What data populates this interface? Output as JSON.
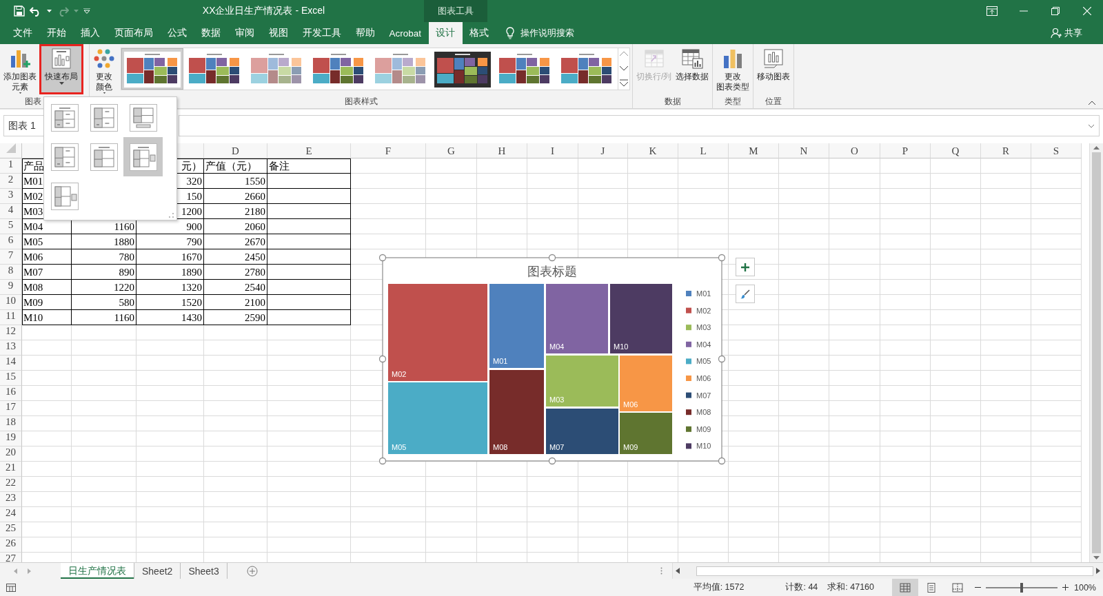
{
  "title_bar": {
    "title": "XX企业日生产情况表 - Excel",
    "context_label": "图表工具"
  },
  "ribbon_tabs": [
    {
      "label": "文件",
      "selected": false
    },
    {
      "label": "开始",
      "selected": false
    },
    {
      "label": "插入",
      "selected": false
    },
    {
      "label": "页面布局",
      "selected": false
    },
    {
      "label": "公式",
      "selected": false
    },
    {
      "label": "数据",
      "selected": false
    },
    {
      "label": "审阅",
      "selected": false
    },
    {
      "label": "视图",
      "selected": false
    },
    {
      "label": "开发工具",
      "selected": false
    },
    {
      "label": "帮助",
      "selected": false
    },
    {
      "label": "Acrobat",
      "selected": false
    },
    {
      "label": "设计",
      "selected": true
    },
    {
      "label": "格式",
      "selected": false
    }
  ],
  "tell_me": "操作说明搜索",
  "share": "共享",
  "ribbon": {
    "groups": [
      {
        "label": "图表",
        "buttons": [
          {
            "kind": "add-element",
            "lines": [
              "添加图表",
              "元素"
            ],
            "dropdown": true,
            "pressed": false,
            "highlighted": false,
            "disabled": false
          },
          {
            "kind": "quick-layout",
            "lines": [
              "快速布局"
            ],
            "dropdown": true,
            "pressed": true,
            "highlighted": true,
            "disabled": false
          }
        ]
      },
      {
        "label": "图表样式",
        "buttons": [
          {
            "kind": "colors",
            "lines": [
              "更改",
              "颜色"
            ],
            "dropdown": true,
            "pressed": false,
            "highlighted": false,
            "disabled": false
          }
        ],
        "gallery": [
          {
            "kind": "light",
            "selected": true
          },
          {
            "kind": "light",
            "selected": false
          },
          {
            "kind": "pale",
            "selected": false
          },
          {
            "kind": "light",
            "selected": false
          },
          {
            "kind": "pale",
            "selected": false
          },
          {
            "kind": "dark",
            "selected": false
          },
          {
            "kind": "light",
            "selected": false
          },
          {
            "kind": "light",
            "selected": false
          }
        ]
      },
      {
        "label": "数据",
        "buttons": [
          {
            "kind": "switch",
            "lines": [
              "切换行/列"
            ],
            "dropdown": false,
            "pressed": false,
            "highlighted": false,
            "disabled": true
          },
          {
            "kind": "select-data",
            "lines": [
              "选择数据"
            ],
            "dropdown": false,
            "pressed": false,
            "highlighted": false,
            "disabled": false
          }
        ]
      },
      {
        "label": "类型",
        "buttons": [
          {
            "kind": "change-type",
            "lines": [
              "更改",
              "图表类型"
            ],
            "dropdown": false,
            "pressed": false,
            "highlighted": false,
            "disabled": false
          }
        ]
      },
      {
        "label": "位置",
        "buttons": [
          {
            "kind": "move",
            "lines": [
              "移动图表"
            ],
            "dropdown": false,
            "pressed": false,
            "highlighted": false,
            "disabled": false
          }
        ]
      }
    ]
  },
  "formula_bar": {
    "name_box": "图表 1"
  },
  "sheet": {
    "column_headers": [
      "D",
      "E",
      "F",
      "G",
      "H",
      "I",
      "J",
      "K",
      "L",
      "M",
      "N",
      "O",
      "P",
      "Q",
      "R",
      "S"
    ],
    "rows": [
      {
        "number": "1",
        "kind": "header",
        "A": "产品",
        "C": "元）",
        "D": "产值（元）",
        "E": "备注"
      },
      {
        "number": "2",
        "kind": "data",
        "A": "M01",
        "C": "320",
        "D": "1550"
      },
      {
        "number": "3",
        "kind": "data",
        "A": "M02",
        "C": "150",
        "D": "2660"
      },
      {
        "number": "4",
        "kind": "data",
        "A": "M03",
        "C": "1200",
        "D": "2180"
      },
      {
        "number": "5",
        "kind": "data",
        "A": "M04",
        "B": "1160",
        "C": "900",
        "D": "2060"
      },
      {
        "number": "6",
        "kind": "data",
        "A": "M05",
        "B": "1880",
        "C": "790",
        "D": "2670"
      },
      {
        "number": "7",
        "kind": "data",
        "A": "M06",
        "B": "780",
        "C": "1670",
        "D": "2450"
      },
      {
        "number": "8",
        "kind": "data",
        "A": "M07",
        "B": "890",
        "C": "1890",
        "D": "2780"
      },
      {
        "number": "9",
        "kind": "data",
        "A": "M08",
        "B": "1220",
        "C": "1320",
        "D": "2540"
      },
      {
        "number": "10",
        "kind": "data",
        "A": "M09",
        "B": "580",
        "C": "1520",
        "D": "2100"
      },
      {
        "number": "11",
        "kind": "data",
        "A": "M10",
        "B": "1160",
        "C": "1430",
        "D": "2590"
      },
      {
        "number": "12"
      },
      {
        "number": "13"
      },
      {
        "number": "14"
      },
      {
        "number": "15"
      },
      {
        "number": "16"
      },
      {
        "number": "17"
      },
      {
        "number": "18"
      },
      {
        "number": "19"
      },
      {
        "number": "20"
      },
      {
        "number": "21"
      },
      {
        "number": "22"
      },
      {
        "number": "23"
      },
      {
        "number": "24"
      },
      {
        "number": "25"
      },
      {
        "number": "26"
      },
      {
        "number": "27"
      }
    ]
  },
  "chart": {
    "title": "图表标题",
    "items": [
      {
        "label": "M02",
        "color": "#c0504d"
      },
      {
        "label": "M01",
        "color": "#4f81bd"
      },
      {
        "label": "M04",
        "color": "#8064a2"
      },
      {
        "label": "M10",
        "color": "#4d3b62"
      },
      {
        "label": "M03",
        "color": "#9bbb59"
      },
      {
        "label": "M06",
        "color": "#f79646"
      },
      {
        "label": "M05",
        "color": "#4bacc6"
      },
      {
        "label": "M08",
        "color": "#772c2a"
      },
      {
        "label": "M07",
        "color": "#2c4d75"
      },
      {
        "label": "M09",
        "color": "#5f7530"
      }
    ],
    "legend": [
      {
        "label": "M01",
        "color": "#4f81bd"
      },
      {
        "label": "M02",
        "color": "#c0504d"
      },
      {
        "label": "M03",
        "color": "#9bbb59"
      },
      {
        "label": "M04",
        "color": "#8064a2"
      },
      {
        "label": "M05",
        "color": "#4bacc6"
      },
      {
        "label": "M06",
        "color": "#f79646"
      },
      {
        "label": "M07",
        "color": "#2c4d75"
      },
      {
        "label": "M08",
        "color": "#772c2a"
      },
      {
        "label": "M09",
        "color": "#5f7530"
      },
      {
        "label": "M10",
        "color": "#4d3b62"
      }
    ]
  },
  "layout_menu": {
    "items": [
      {
        "selected": false
      },
      {
        "selected": false
      },
      {
        "selected": false
      },
      {
        "selected": false
      },
      {
        "selected": false
      },
      {
        "selected": true
      },
      {
        "selected": false
      }
    ]
  },
  "sheet_tabs": [
    {
      "label": "日生产情况表",
      "selected": true
    },
    {
      "label": "Sheet2",
      "selected": false
    },
    {
      "label": "Sheet3",
      "selected": false
    }
  ],
  "status_bar": {
    "average": "平均值: 1572",
    "count": "计数: 44",
    "sum": "求和: 47160",
    "views": [
      {
        "selected": true
      },
      {
        "selected": false
      },
      {
        "selected": false
      }
    ],
    "zoom_slider": {
      "level": 0.5
    },
    "zoom": "100%"
  }
}
